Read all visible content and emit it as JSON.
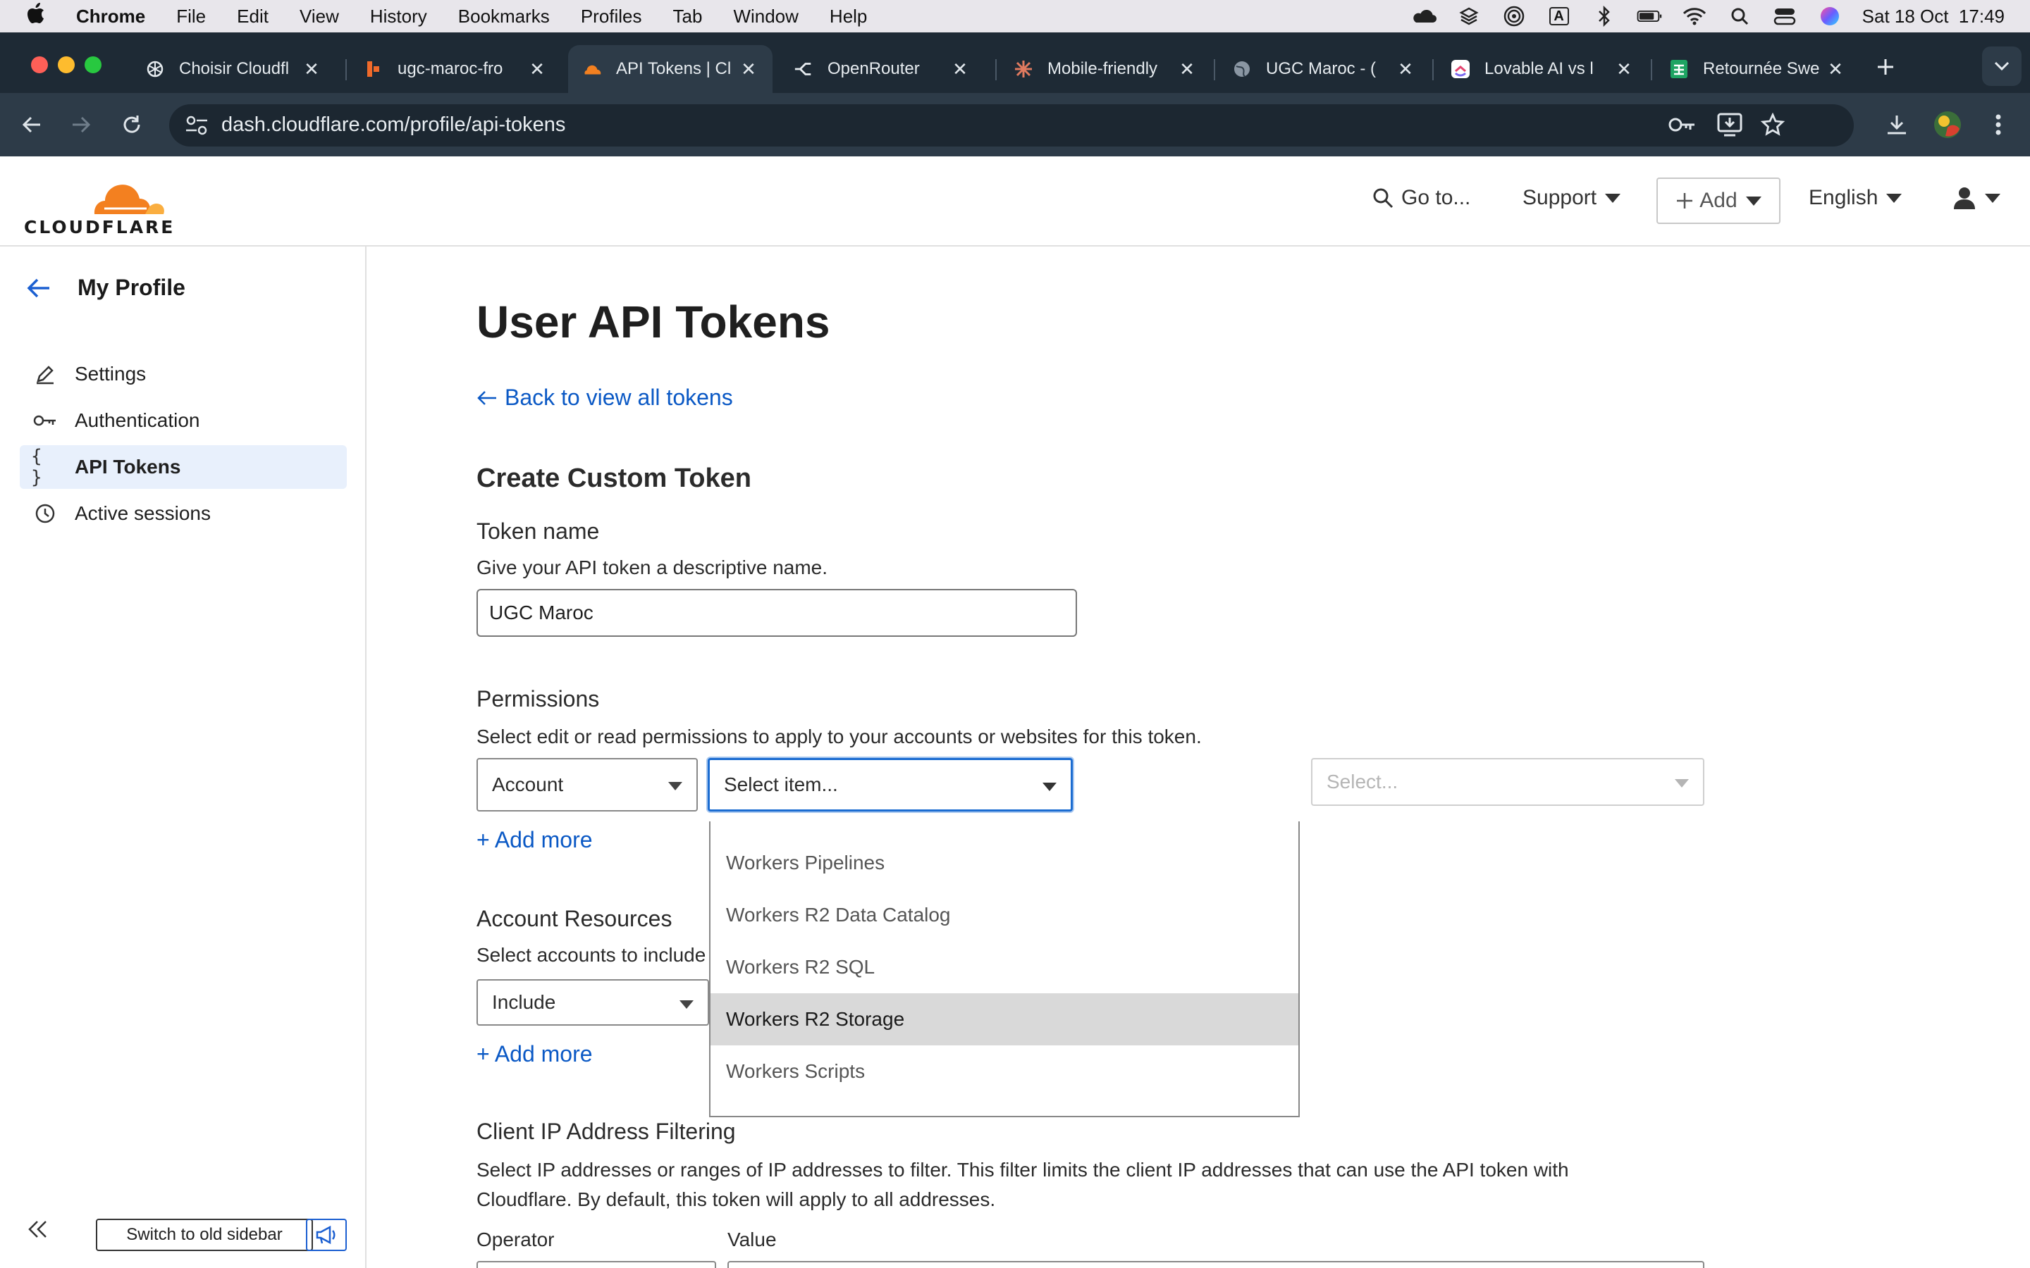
{
  "menubar": {
    "app": "Chrome",
    "items": [
      "File",
      "Edit",
      "View",
      "History",
      "Bookmarks",
      "Profiles",
      "Tab",
      "Window",
      "Help"
    ],
    "datetime": "Sat 18 Oct  17:49",
    "status_icons": [
      "cloud-icon",
      "stack-icon",
      "airdrop-icon",
      "input-source-icon",
      "bluetooth-icon",
      "battery-icon",
      "wifi-icon",
      "spotlight-icon",
      "control-center-icon",
      "siri-icon"
    ],
    "input_source": "A"
  },
  "tabs": [
    {
      "title": "Choisir Cloudfl",
      "icon": "openai-icon"
    },
    {
      "title": "ugc-maroc-fro",
      "icon": "bolt-icon"
    },
    {
      "title": "API Tokens | Cl",
      "icon": "cloudflare-icon",
      "active": true
    },
    {
      "title": "OpenRouter",
      "icon": "openrouter-icon"
    },
    {
      "title": "Mobile-friendly",
      "icon": "claude-icon"
    },
    {
      "title": "UGC Maroc - (",
      "icon": "globe-icon"
    },
    {
      "title": "Lovable AI vs l",
      "icon": "clickup-icon"
    },
    {
      "title": "Retournée Swe",
      "icon": "sheets-icon"
    }
  ],
  "addressbar": {
    "url": "dash.cloudflare.com/profile/api-tokens"
  },
  "header": {
    "logo_text": "CLOUDFLARE",
    "goto": "Go to...",
    "support": "Support",
    "add": "Add",
    "language": "English"
  },
  "sidebar": {
    "title": "My Profile",
    "items": [
      {
        "label": "Settings",
        "icon": "pencil-icon"
      },
      {
        "label": "Authentication",
        "icon": "key-icon"
      },
      {
        "label": "API Tokens",
        "icon": "braces-icon",
        "active": true
      },
      {
        "label": "Active sessions",
        "icon": "clock-icon"
      }
    ],
    "switch_label": "Switch to old sidebar"
  },
  "main": {
    "title": "User API Tokens",
    "back_link": "Back to view all tokens",
    "section_title": "Create Custom Token",
    "token_name": {
      "label": "Token name",
      "help": "Give your API token a descriptive name.",
      "value": "UGC Maroc"
    },
    "permissions": {
      "label": "Permissions",
      "help": "Select edit or read permissions to apply to your accounts or websites for this token.",
      "scope_value": "Account",
      "item_placeholder": "Select item...",
      "access_placeholder": "Select...",
      "add_more": "+ Add more",
      "dropdown_options": [
        "Workers Pipelines",
        "Workers R2 Data Catalog",
        "Workers R2 SQL",
        "Workers R2 Storage",
        "Workers Scripts"
      ],
      "highlighted_option": "Workers R2 Storage"
    },
    "account_resources": {
      "label": "Account Resources",
      "help": "Select accounts to include",
      "value": "Include",
      "add_more": "+ Add more"
    },
    "ip_filtering": {
      "label": "Client IP Address Filtering",
      "help_line1": "Select IP addresses or ranges of IP addresses to filter. This filter limits the client IP addresses that can use the API token with",
      "help_line2": "Cloudflare. By default, this token will apply to all addresses.",
      "operator_label": "Operator",
      "value_label": "Value"
    }
  },
  "colors": {
    "link": "#0b59c5",
    "focus": "#1b6cd1",
    "cloudflare_orange": "#f38020",
    "tabstrip": "#1e2a35",
    "toolbar": "#2d3b48"
  }
}
